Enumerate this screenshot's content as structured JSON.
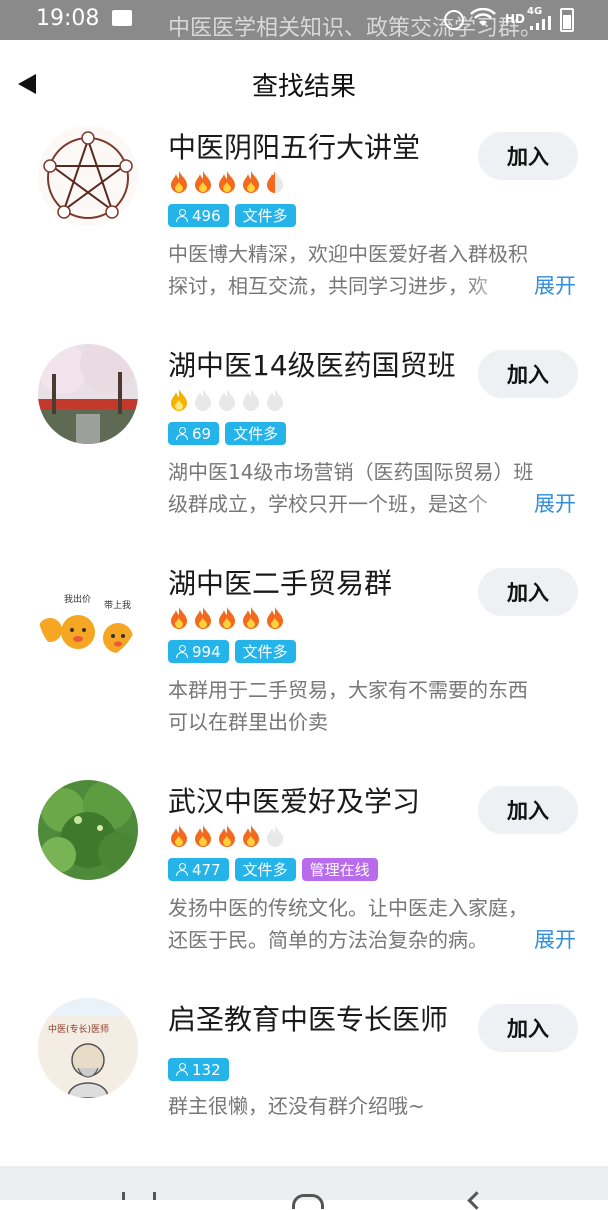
{
  "status_bar": {
    "time": "19:08",
    "hd": "HD",
    "network": "4G",
    "behind_text": "中医医学相关知识、政策交流学习群。"
  },
  "header": {
    "title": "查找结果",
    "back_icon": "back-arrow-icon"
  },
  "colors": {
    "tag_blue": "#24b4ea",
    "tag_purple": "#b86bea",
    "link": "#2f8fe0",
    "flame": "#f36a1f"
  },
  "groups": [
    {
      "name": "中医阴阳五行大讲堂",
      "flames": 4.5,
      "members": "496",
      "tags": [
        "文件多"
      ],
      "desc": [
        "中医博大精深，欢迎中医爱好者入群极积",
        "探讨，相互交流，共同学习进步，欢"
      ],
      "expand": "展开",
      "join": "加入",
      "avatar_icon": "five-elements-pentagram-icon"
    },
    {
      "name": "湖中医14级医药国贸班",
      "flames": 1,
      "members": "69",
      "tags": [
        "文件多"
      ],
      "desc": [
        "湖中医14级市场营销（医药国际贸易）班",
        "级群成立，学校只开一个班，是这个"
      ],
      "expand": "展开",
      "join": "加入",
      "avatar_icon": "campus-photo-icon"
    },
    {
      "name": "湖中医二手贸易群",
      "flames": 5,
      "members": "994",
      "tags": [
        "文件多"
      ],
      "desc": [
        "本群用于二手贸易，大家有不需要的东西",
        "可以在群里出价卖"
      ],
      "expand": "",
      "join": "加入",
      "avatar_icon": "cartoon-bears-icon",
      "avatar_text_1": "我出价",
      "avatar_text_2": "带上我"
    },
    {
      "name": "武汉中医爱好及学习",
      "flames": 4,
      "members": "477",
      "tags": [
        "文件多",
        "管理在线"
      ],
      "desc": [
        "发扬中医的传统文化。让中医走入家庭，",
        "还医于民。简单的方法治复杂的病。"
      ],
      "expand": "展开",
      "join": "加入",
      "avatar_icon": "green-tree-photo-icon"
    },
    {
      "name": "启圣教育中医专长医师",
      "flames": 0,
      "members": "132",
      "tags": [],
      "desc": [
        "群主很懒，还没有群介绍哦~"
      ],
      "expand": "",
      "join": "加入",
      "avatar_icon": "tcm-doctor-portrait-icon",
      "avatar_text_1": "中医(专长)医师"
    }
  ]
}
